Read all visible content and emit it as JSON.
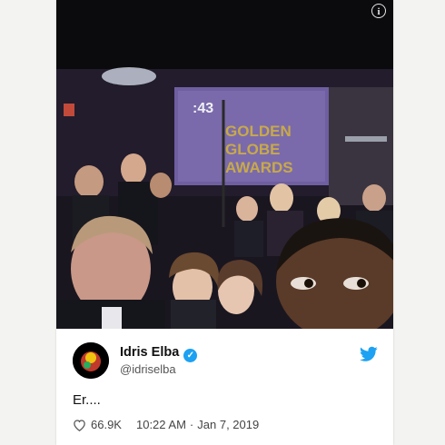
{
  "tweet": {
    "display_name": "Idris Elba",
    "handle": "@idriselba",
    "text": "Er....",
    "likes": "66.9K",
    "time": "10:22 AM",
    "separator": "·",
    "date": "Jan 7, 2019",
    "verified": true
  },
  "media": {
    "screen_timer": ":43",
    "screen_title_lines": [
      "GOLDEN",
      "GLOBE",
      "AWARDS"
    ]
  },
  "icons": {
    "info": "info-icon",
    "bird": "twitter-bird-icon",
    "verified": "verified-badge-icon",
    "heart": "heart-icon"
  },
  "colors": {
    "twitter_blue": "#1da1f2",
    "screen_purple": "#6f5fa0",
    "gold": "#c8a94a"
  }
}
